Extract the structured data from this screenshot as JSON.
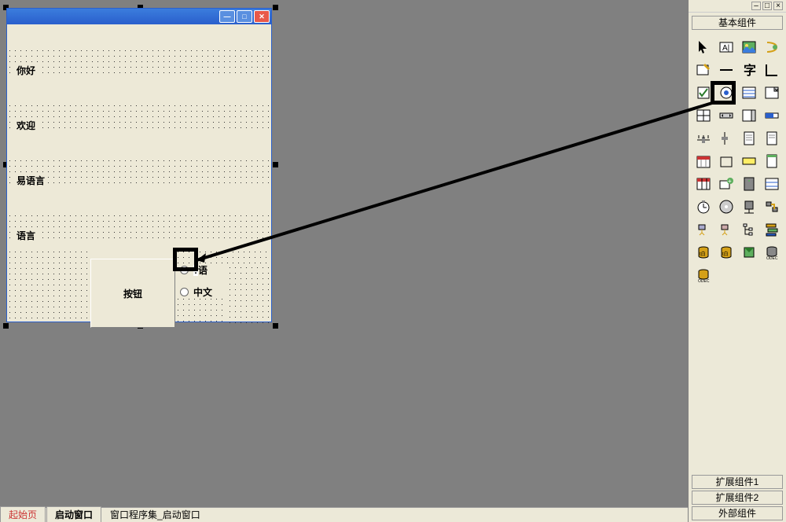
{
  "form": {
    "labels": {
      "l1": "你好",
      "l2": "欢迎",
      "l3": "易语言",
      "l4": "语言"
    },
    "button_label": "按钮",
    "radios": {
      "r1": "语",
      "r2": "中文"
    }
  },
  "tabs": {
    "t1": "起始页",
    "t2": "启动窗口",
    "t3": "窗口程序集_启动窗口"
  },
  "palette": {
    "header": "基本组件",
    "bottom1": "扩展组件1",
    "bottom2": "扩展组件2",
    "bottom3": "外部组件"
  },
  "icon_names": {
    "pointer": "pointer-icon",
    "label": "label-icon",
    "image": "image-icon",
    "shape": "shape-icon",
    "edit": "edit-icon",
    "dash": "dash-icon",
    "text": "text-icon",
    "angle": "angle-icon",
    "checkbox": "checkbox-icon",
    "radio": "radio-icon",
    "listbox": "listbox-icon",
    "grid2": "grid2-icon",
    "gridh": "gridh-icon",
    "sliderh": "sliderh-icon",
    "grid3": "grid3-icon",
    "barh": "barh-icon",
    "dotsl": "dotsl-icon",
    "dotsr": "dotsr-icon",
    "doc1": "doc1-icon",
    "doc2": "doc2-icon",
    "cal": "calendar-icon",
    "cell": "cell-icon",
    "yellow": "yellow-icon",
    "note": "note-icon",
    "table1": "table1-icon",
    "plus": "plus-icon",
    "server": "server-icon",
    "table2": "table2-icon",
    "clock": "clock-icon",
    "disk1": "disk1-icon",
    "server2": "server2-icon",
    "conn": "conn-icon",
    "net1": "net1-icon",
    "net2": "net2-icon",
    "tree": "tree-icon",
    "stack": "stack-icon",
    "db1": "db1-icon",
    "db2": "db2-icon",
    "tank": "tank-icon",
    "odbc": "odbc-icon",
    "db3": "db3-icon"
  }
}
